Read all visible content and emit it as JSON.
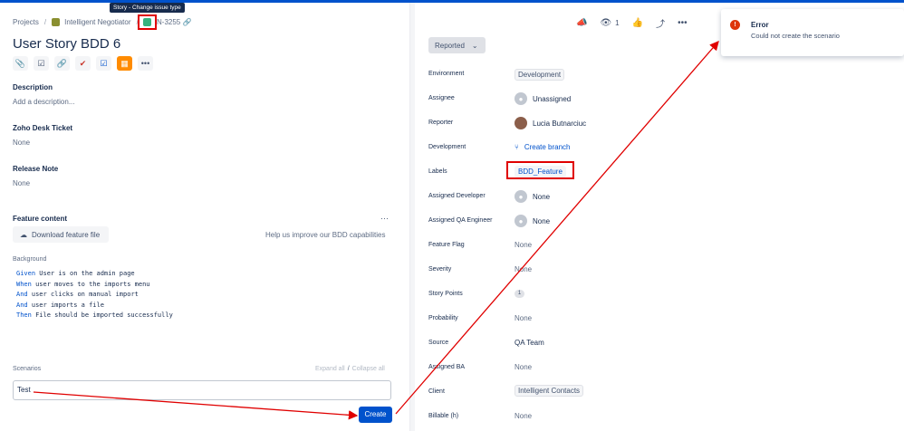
{
  "breadcrumb": {
    "projects": "Projects",
    "project": "Intelligent Negotiator",
    "issue_key": "N-3255"
  },
  "tooltip": "Story - Change issue type",
  "issue": {
    "title": "User Story BDD 6"
  },
  "toolbar_icons": [
    "paperclip-icon",
    "checklist-icon",
    "link-icon",
    "app-icon",
    "checkbox-icon",
    "grid-app-icon",
    "more-icon"
  ],
  "description": {
    "label": "Description",
    "placeholder": "Add a description..."
  },
  "zoho": {
    "label": "Zoho Desk Ticket",
    "value": "None"
  },
  "release_note": {
    "label": "Release Note",
    "value": "None"
  },
  "feature_content": {
    "label": "Feature content",
    "download_label": "Download feature file",
    "help_text": "Help us improve our BDD capabilities",
    "more": "···"
  },
  "background": {
    "label": "Background",
    "steps": [
      {
        "keyword": "Given",
        "text": " User is on the admin page"
      },
      {
        "keyword": "When",
        "text": " user moves to the imports menu"
      },
      {
        "keyword": "And",
        "text": " user clicks on manual import"
      },
      {
        "keyword": "And",
        "text": " user imports a file"
      },
      {
        "keyword": "Then",
        "text": " File should be imported successfully"
      }
    ]
  },
  "scenarios": {
    "label": "Scenarios",
    "expand_all": "Expand all",
    "slash": "/",
    "collapse_all": "Collapse all",
    "input_value": "Test",
    "create_label": "Create"
  },
  "header_actions": {
    "watch_count": "1"
  },
  "status": {
    "label": "Reported"
  },
  "fields": {
    "environment": {
      "label": "Environment",
      "value": "Development"
    },
    "assignee": {
      "label": "Assignee",
      "value": "Unassigned"
    },
    "reporter": {
      "label": "Reporter",
      "value": "Lucia Butnarciuc"
    },
    "development": {
      "label": "Development",
      "value": "Create branch"
    },
    "labels": {
      "label": "Labels",
      "value": "BDD_Feature"
    },
    "assigned_developer": {
      "label": "Assigned Developer",
      "value": "None"
    },
    "assigned_qa": {
      "label": "Assigned QA Engineer",
      "value": "None"
    },
    "feature_flag": {
      "label": "Feature Flag",
      "value": "None"
    },
    "severity": {
      "label": "Severity",
      "value": "None"
    },
    "story_points": {
      "label": "Story Points",
      "value": "1"
    },
    "probability": {
      "label": "Probability",
      "value": "None"
    },
    "source": {
      "label": "Source",
      "value": "QA Team"
    },
    "assigned_ba": {
      "label": "Assigned BA",
      "value": "None"
    },
    "client": {
      "label": "Client",
      "value": "Intelligent Contacts"
    },
    "billable": {
      "label": "Billable (h)",
      "value": "None"
    }
  },
  "toast": {
    "title": "Error",
    "message": "Could not create the scenario"
  },
  "colors": {
    "accent": "#0052cc",
    "annotation": "#e00000",
    "error": "#de350b"
  }
}
